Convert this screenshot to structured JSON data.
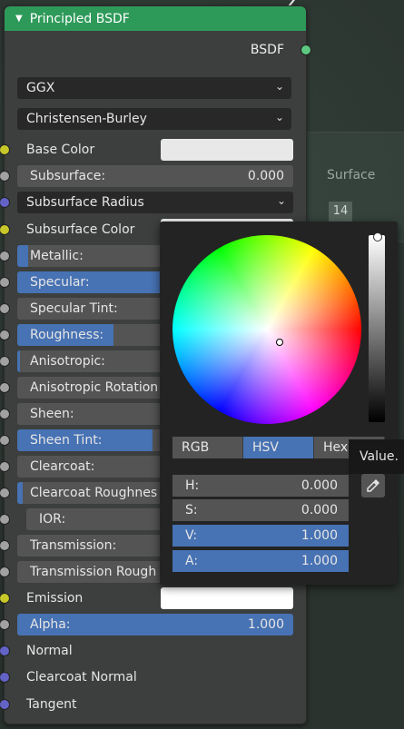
{
  "node": {
    "title": "Principled BSDF",
    "output": "BSDF",
    "distribution": "GGX",
    "subsurface_method": "Christensen-Burley"
  },
  "inputs": {
    "base_color": "Base Color",
    "subsurface": {
      "label": "Subsurface:",
      "value": "0.000"
    },
    "subsurface_radius": "Subsurface Radius",
    "subsurface_color": "Subsurface Color",
    "metallic": {
      "label": "Metallic:",
      "fill": 0.04
    },
    "specular": {
      "label": "Specular:",
      "fill": 0.5
    },
    "specular_tint": {
      "label": "Specular Tint:"
    },
    "roughness": {
      "label": "Roughness:",
      "fill": 0.36
    },
    "anisotropic": {
      "label": "Anisotropic:",
      "fill": 0.01
    },
    "anisotropic_rotation": {
      "label": "Anisotropic Rotation"
    },
    "sheen": {
      "label": "Sheen:"
    },
    "sheen_tint": {
      "label": "Sheen Tint:",
      "fill": 0.5
    },
    "clearcoat": {
      "label": "Clearcoat:"
    },
    "clearcoat_roughness": {
      "label": "Clearcoat Roughnes",
      "fill": 0.03
    },
    "ior": {
      "label": "IOR:"
    },
    "transmission": {
      "label": "Transmission:"
    },
    "transmission_roughness": {
      "label": "Transmission Rough"
    },
    "emission": "Emission",
    "alpha": {
      "label": "Alpha:",
      "value": "1.000"
    },
    "normal": "Normal",
    "clearcoat_normal": "Clearcoat Normal",
    "tangent": "Tangent"
  },
  "background": {
    "surface_label": "Surface",
    "count": "14"
  },
  "color_picker": {
    "tabs": [
      "RGB",
      "HSV",
      "Hex"
    ],
    "active_tab": "HSV",
    "value_level": 1.0,
    "h": {
      "label": "H:",
      "value": "0.000"
    },
    "s": {
      "label": "S:",
      "value": "0.000"
    },
    "v": {
      "label": "V:",
      "value": "1.000"
    },
    "a": {
      "label": "A:",
      "value": "1.000"
    },
    "tooltip": "Value.",
    "eyedropper_icon": "eyedropper-icon"
  },
  "colors": {
    "header": "#2e9a5a",
    "accent": "#4772b3",
    "socket_color": "#c7c729",
    "socket_float": "#a1a1a1",
    "socket_vector": "#6363c7",
    "socket_shader": "#5ec880"
  }
}
